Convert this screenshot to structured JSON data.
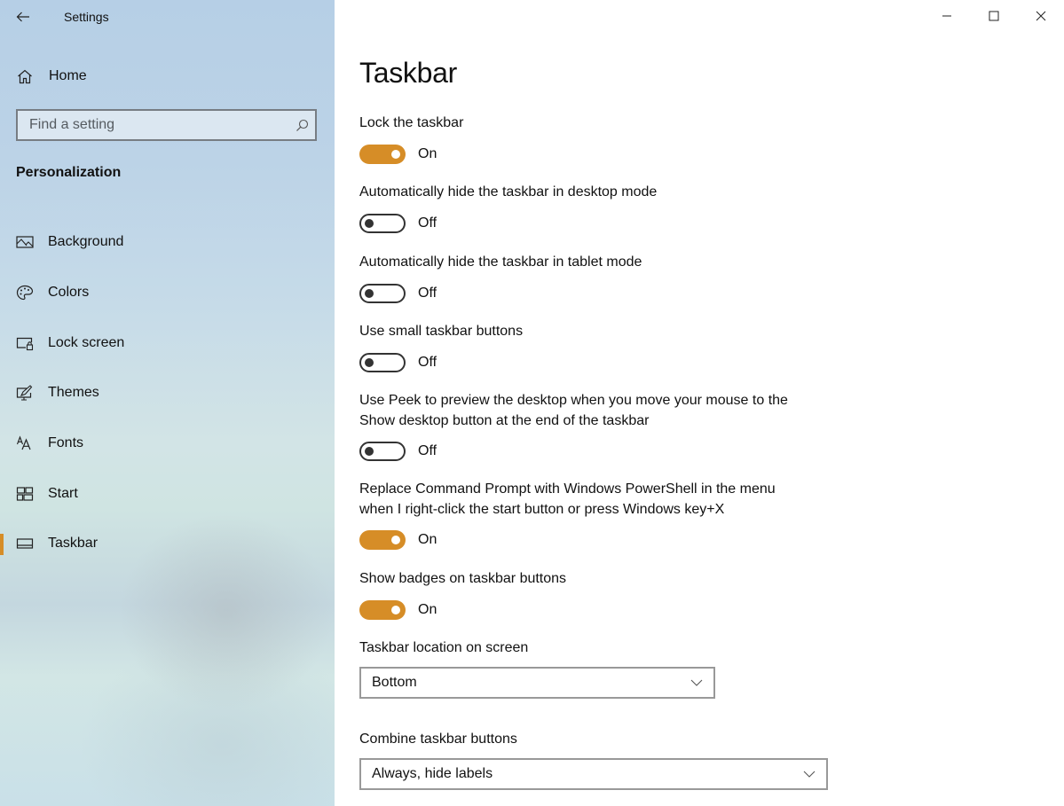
{
  "window": {
    "app_title": "Settings",
    "caption_buttons": [
      "minimize",
      "maximize",
      "close"
    ]
  },
  "sidebar": {
    "home_label": "Home",
    "search_placeholder": "Find a setting",
    "section_title": "Personalization",
    "items": [
      {
        "label": "Background",
        "icon": "picture-icon",
        "active": false
      },
      {
        "label": "Colors",
        "icon": "palette-icon",
        "active": false
      },
      {
        "label": "Lock screen",
        "icon": "lock-screen-icon",
        "active": false
      },
      {
        "label": "Themes",
        "icon": "themes-icon",
        "active": false
      },
      {
        "label": "Fonts",
        "icon": "fonts-icon",
        "active": false
      },
      {
        "label": "Start",
        "icon": "start-icon",
        "active": false
      },
      {
        "label": "Taskbar",
        "icon": "taskbar-icon",
        "active": true
      }
    ]
  },
  "main": {
    "title": "Taskbar",
    "toggles": [
      {
        "label": "Lock the taskbar",
        "state": "On",
        "on": true
      },
      {
        "label": "Automatically hide the taskbar in desktop mode",
        "state": "Off",
        "on": false
      },
      {
        "label": "Automatically hide the taskbar in tablet mode",
        "state": "Off",
        "on": false
      },
      {
        "label": "Use small taskbar buttons",
        "state": "Off",
        "on": false
      },
      {
        "label": "Use Peek to preview the desktop when you move your mouse to the Show desktop button at the end of the taskbar",
        "state": "Off",
        "on": false
      },
      {
        "label": "Replace Command Prompt with Windows PowerShell in the menu when I right-click the start button or press Windows key+X",
        "state": "On",
        "on": true
      },
      {
        "label": "Show badges on taskbar buttons",
        "state": "On",
        "on": true
      }
    ],
    "dropdowns": [
      {
        "label": "Taskbar location on screen",
        "value": "Bottom"
      },
      {
        "label": "Combine taskbar buttons",
        "value": "Always, hide labels"
      }
    ]
  },
  "colors": {
    "accent": "#d68d27",
    "toggle_off_border": "#333333"
  }
}
